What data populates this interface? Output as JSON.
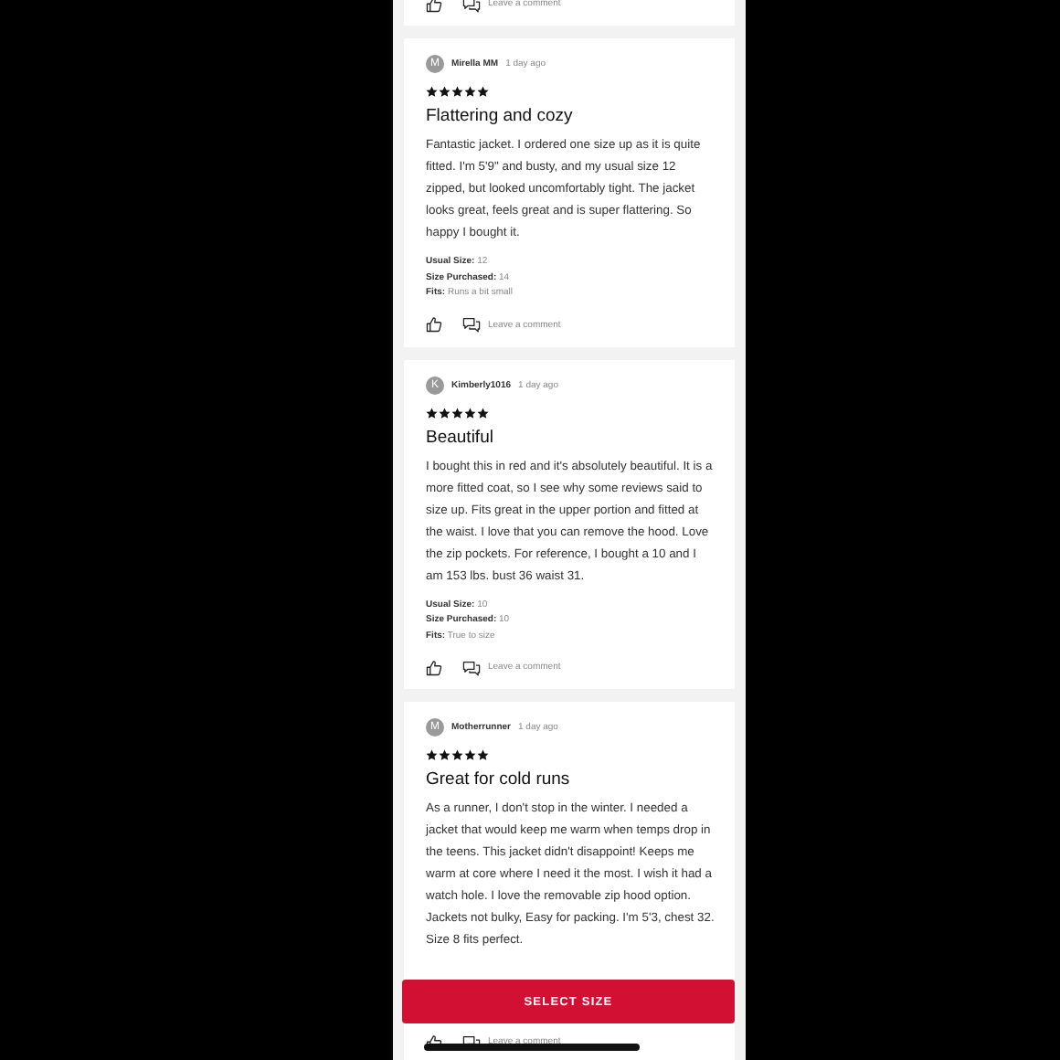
{
  "reviews": [
    {
      "comment_link": "Leave a comment"
    },
    {
      "avatar": "M",
      "author": "Mirella MM",
      "time": "1 day ago",
      "stars": 5,
      "title": "Flattering and cozy",
      "body": "Fantastic jacket. I ordered one size up as it is quite fitted. I'm 5'9\" and busty, and my usual size 12 zipped, but looked uncomfortably tight. The jacket looks great, feels great and is super flattering. So happy I bought it.",
      "specs": [
        {
          "label": "Usual Size:",
          "value": "12"
        },
        {
          "label": "Size Purchased:",
          "value": "14"
        },
        {
          "label": "Fits:",
          "value": "Runs a bit small"
        }
      ],
      "comment_link": "Leave a comment"
    },
    {
      "avatar": "K",
      "author": "Kimberly1016",
      "time": "1 day ago",
      "stars": 5,
      "title": "Beautiful",
      "body": "I bought this in red and it's absolutely beautiful. It is a more fitted coat, so I see why some reviews said to size up. Fits great in the upper portion and fitted at the waist. I love that you can remove the hood. Love the zip pockets. For reference, I bought a 10 and I am 153 lbs. bust 36 waist 31.",
      "specs": [
        {
          "label": "Usual Size:",
          "value": "10"
        },
        {
          "label": "Size Purchased:",
          "value": "10"
        },
        {
          "label": "Fits:",
          "value": "True to size"
        }
      ],
      "comment_link": "Leave a comment"
    },
    {
      "avatar": "M",
      "author": "Motherrunner",
      "time": "1 day ago",
      "stars": 5,
      "title": "Great for cold runs",
      "body": "As a runner, I don't stop in the winter. I needed a jacket that would keep me warm when temps drop in the teens. This jacket didn't disappoint! Keeps me warm at core where I need it the most. I wish it had a watch hole. I love the removable zip hood option. Jackets not bulky, Easy for packing. I'm 5'3, chest 32. Size 8 fits perfect.",
      "comment_link": "Leave a comment"
    }
  ],
  "select_size_button": "SELECT SIZE"
}
